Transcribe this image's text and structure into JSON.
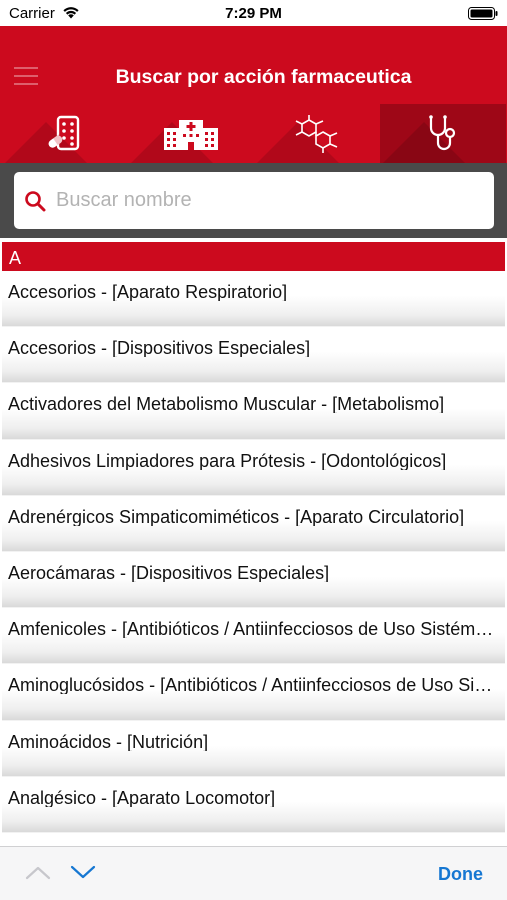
{
  "status_bar": {
    "carrier": "Carrier",
    "time": "7:29 PM"
  },
  "header": {
    "title": "Buscar por acción farmaceutica",
    "menu_icon": "hamburger-icon",
    "tabs": [
      {
        "icon": "pills-icon",
        "active": false
      },
      {
        "icon": "hospital-icon",
        "active": false
      },
      {
        "icon": "molecule-icon",
        "active": false
      },
      {
        "icon": "stethoscope-icon",
        "active": true
      }
    ]
  },
  "search": {
    "placeholder": "Buscar nombre",
    "value": ""
  },
  "list": {
    "section": "A",
    "items": [
      "Accesorios - [Aparato Respiratorio]",
      "Accesorios - [Dispositivos Especiales]",
      "Activadores del Metabolismo Muscular - [Metabolismo]",
      "Adhesivos Limpiadores para Prótesis - [Odontológicos]",
      "Adrenérgicos Simpaticomiméticos - [Aparato Circulatorio]",
      "Aerocámaras - [Dispositivos Especiales]",
      "Amfenicoles - [Antibióticos / Antiinfecciosos de Uso Sistémico]",
      "Aminoglucósidos - [Antibióticos / Antiinfecciosos de Uso Sistémico]",
      "Aminoácidos - [Nutrición]",
      "Analgésico - [Aparato Locomotor]"
    ]
  },
  "toolbar": {
    "done_label": "Done"
  },
  "colors": {
    "brand_red": "#cc0a1e",
    "active_tab": "#9e0717",
    "link_blue": "#1677d2"
  }
}
